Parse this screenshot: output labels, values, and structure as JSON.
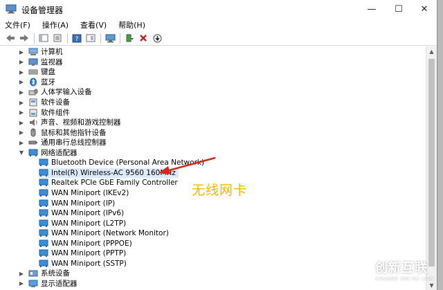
{
  "window": {
    "title": "设备管理器",
    "controls": {
      "minimize": "—",
      "maximize": "☐",
      "close": "✕"
    }
  },
  "menu": [
    "文件(F)",
    "操作(A)",
    "查看(V)",
    "帮助(H)"
  ],
  "tree": {
    "categories_top": [
      {
        "label": "计算机",
        "icon": "computer-icon"
      },
      {
        "label": "监视器",
        "icon": "monitor-icon"
      },
      {
        "label": "键盘",
        "icon": "keyboard-icon"
      },
      {
        "label": "蓝牙",
        "icon": "bluetooth-icon"
      },
      {
        "label": "人体学输入设备",
        "icon": "hid-icon"
      },
      {
        "label": "软件设备",
        "icon": "software-device-icon"
      },
      {
        "label": "软件组件",
        "icon": "software-component-icon"
      },
      {
        "label": "声音、视频和游戏控制器",
        "icon": "sound-icon"
      },
      {
        "label": "鼠标和其他指针设备",
        "icon": "mouse-icon"
      },
      {
        "label": "通用串行总线控制器",
        "icon": "usb-icon"
      }
    ],
    "network": {
      "label": "网络适配器",
      "children": [
        "Bluetooth Device (Personal Area Network)",
        "Intel(R) Wireless-AC 9560 160MHz",
        "Realtek PCIe GbE Family Controller",
        "WAN Miniport (IKEv2)",
        "WAN Miniport (IP)",
        "WAN Miniport (IPv6)",
        "WAN Miniport (L2TP)",
        "WAN Miniport (Network Monitor)",
        "WAN Miniport (PPPOE)",
        "WAN Miniport (PPTP)",
        "WAN Miniport (SSTP)"
      ]
    },
    "categories_bottom": [
      {
        "label": "系统设备",
        "icon": "system-device-icon"
      },
      {
        "label": "显示适配器",
        "icon": "display-adapter-icon"
      }
    ]
  },
  "annotation": {
    "text": "无线网卡",
    "color": "#f5b700",
    "arrow_color": "#d9261c"
  },
  "watermark": {
    "cn": "创新互联",
    "en": "CHUANG XIN HU LIAN"
  },
  "colors": {
    "selection": "#dcebfc",
    "network_icon": "#2f8fd8"
  }
}
